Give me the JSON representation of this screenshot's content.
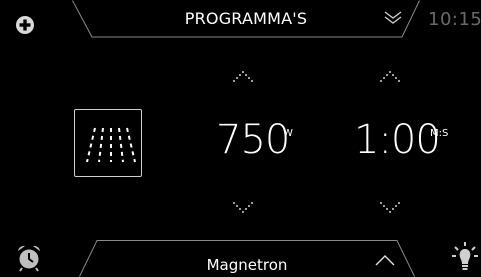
{
  "header": {
    "title": "PROGRAMMA'S",
    "clock": "10:15"
  },
  "mode": {
    "icon": "grill-heat-icon"
  },
  "power": {
    "value": "750",
    "unit": "W"
  },
  "time": {
    "value": "1:00",
    "unit": "M:S"
  },
  "footer": {
    "title": "Magnetron"
  },
  "icons": {
    "top_left": "plus-icon",
    "bottom_left": "alarm-clock-icon",
    "bottom_right": "lamp-icon"
  },
  "colors": {
    "background": "#000000",
    "text": "#ffffff",
    "muted": "#6a6a6a",
    "outline": "#9a9a9a"
  }
}
